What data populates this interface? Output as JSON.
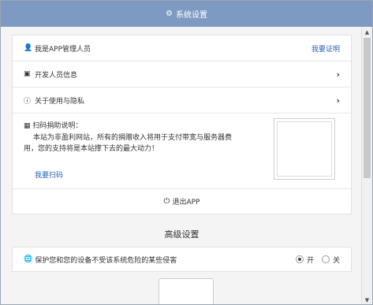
{
  "header": {
    "title": "系统设置",
    "gear_icon": "gear-icon"
  },
  "rows": {
    "admin": {
      "label": "我是APP管理人员",
      "link": "我要证明"
    },
    "dev": {
      "label": "开发人员信息"
    },
    "about": {
      "label": "关于使用与隐私"
    }
  },
  "donate": {
    "title": "扫码捐助说明：",
    "desc": "本站为非盈利网站，所有的捐赠收入将用于支付带宽与服务器费用，您的支持将是本站撑下去的最大动力！",
    "scan_link": "我要扫码"
  },
  "logout": {
    "label": "退出APP"
  },
  "advanced": {
    "title": "高级设置",
    "protect_label": "保护您和您的设备不受该系统危险的某些侵害",
    "on_label": "开",
    "off_label": "关",
    "selected": "on"
  },
  "colors": {
    "header_bg": "#7f9ac2",
    "link": "#2a62b8"
  }
}
